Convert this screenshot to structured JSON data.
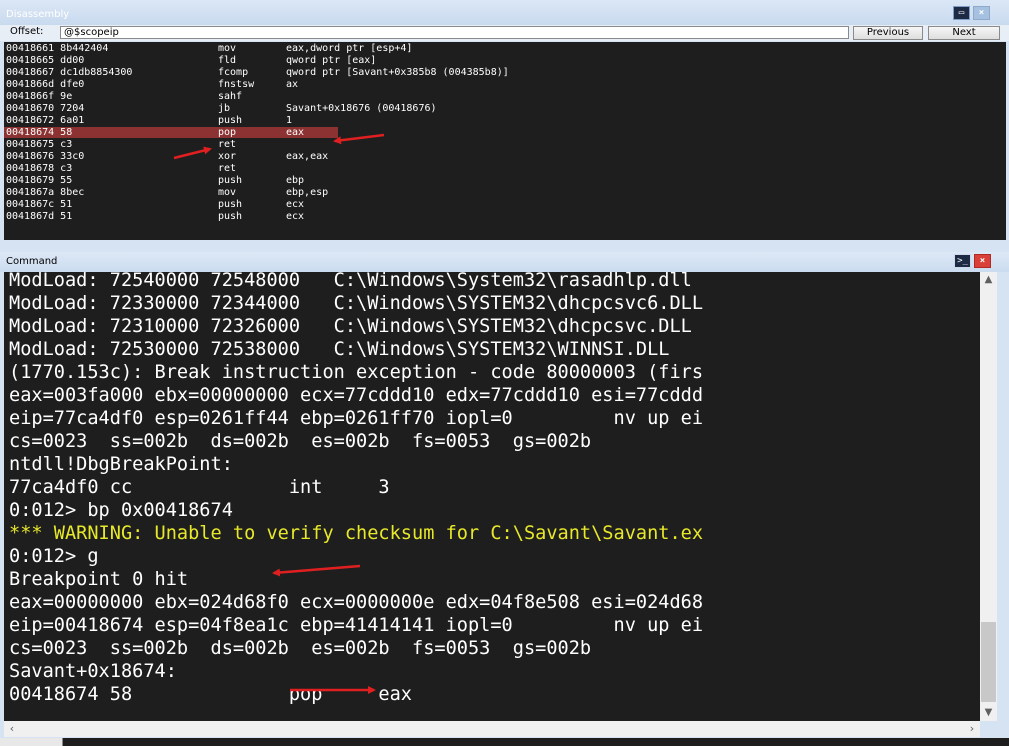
{
  "disassembly": {
    "title": "Disassembly",
    "offset_label": "Offset:",
    "offset_value": "@$scopeip",
    "previous_label": "Previous",
    "next_label": "Next",
    "rows": [
      {
        "addr": "00418661 8b442404",
        "mnemonic": "mov",
        "operands": "eax,dword ptr [esp+4]"
      },
      {
        "addr": "00418665 dd00",
        "mnemonic": "fld",
        "operands": "qword ptr [eax]"
      },
      {
        "addr": "00418667 dc1db8854300",
        "mnemonic": "fcomp",
        "operands": "qword ptr [Savant+0x385b8 (004385b8)]"
      },
      {
        "addr": "0041866d dfe0",
        "mnemonic": "fnstsw",
        "operands": "ax"
      },
      {
        "addr": "0041866f 9e",
        "mnemonic": "sahf",
        "operands": ""
      },
      {
        "addr": "00418670 7204",
        "mnemonic": "jb",
        "operands": "Savant+0x18676 (00418676)"
      },
      {
        "addr": "00418672 6a01",
        "mnemonic": "push",
        "operands": "1"
      },
      {
        "addr": "00418674 58",
        "mnemonic": "pop",
        "operands": "eax"
      },
      {
        "addr": "00418675 c3",
        "mnemonic": "ret",
        "operands": ""
      },
      {
        "addr": "00418676 33c0",
        "mnemonic": "xor",
        "operands": "eax,eax"
      },
      {
        "addr": "00418678 c3",
        "mnemonic": "ret",
        "operands": ""
      },
      {
        "addr": "00418679 55",
        "mnemonic": "push",
        "operands": "ebp"
      },
      {
        "addr": "0041867a 8bec",
        "mnemonic": "mov",
        "operands": "ebp,esp"
      },
      {
        "addr": "0041867c 51",
        "mnemonic": "push",
        "operands": "ecx"
      },
      {
        "addr": "0041867d 51",
        "mnemonic": "push",
        "operands": "ecx"
      }
    ],
    "highlighted_row": 7
  },
  "command": {
    "title": "Command",
    "lines": [
      "ModLoad: 72540000 72548000   C:\\Windows\\System32\\rasadhlp.dll",
      "ModLoad: 72330000 72344000   C:\\Windows\\SYSTEM32\\dhcpcsvc6.DLL",
      "ModLoad: 72310000 72326000   C:\\Windows\\SYSTEM32\\dhcpcsvc.DLL",
      "ModLoad: 72530000 72538000   C:\\Windows\\SYSTEM32\\WINNSI.DLL",
      "(1770.153c): Break instruction exception - code 80000003 (firs",
      "eax=003fa000 ebx=00000000 ecx=77cddd10 edx=77cddd10 esi=77cddd",
      "eip=77ca4df0 esp=0261ff44 ebp=0261ff70 iopl=0         nv up ei",
      "cs=0023  ss=002b  ds=002b  es=002b  fs=0053  gs=002b",
      "ntdll!DbgBreakPoint:",
      "77ca4df0 cc              int     3",
      "0:012> bp 0x00418674",
      "*** WARNING: Unable to verify checksum for C:\\Savant\\Savant.ex",
      "0:012> g",
      "Breakpoint 0 hit",
      "eax=00000000 ebx=024d68f0 ecx=0000000e edx=04f8e508 esi=024d68",
      "eip=00418674 esp=04f8ea1c ebp=41414141 iopl=0         nv up ei",
      "cs=0023  ss=002b  ds=002b  es=002b  fs=0053  gs=002b",
      "Savant+0x18674:",
      "00418674 58              pop     eax"
    ],
    "warning_line_index": 11
  },
  "icons": {
    "options": "window-options-icon",
    "close": "close-icon",
    "console": "console-icon",
    "scroll_up": "scroll-up-icon",
    "scroll_down": "scroll-down-icon",
    "scroll_left": "scroll-left-icon",
    "scroll_right": "scroll-right-icon"
  },
  "colors": {
    "background": "#1e1e1e",
    "highlight": "#8c3232",
    "warning_text": "#e8e82a",
    "annotation_arrow": "#e02020"
  }
}
